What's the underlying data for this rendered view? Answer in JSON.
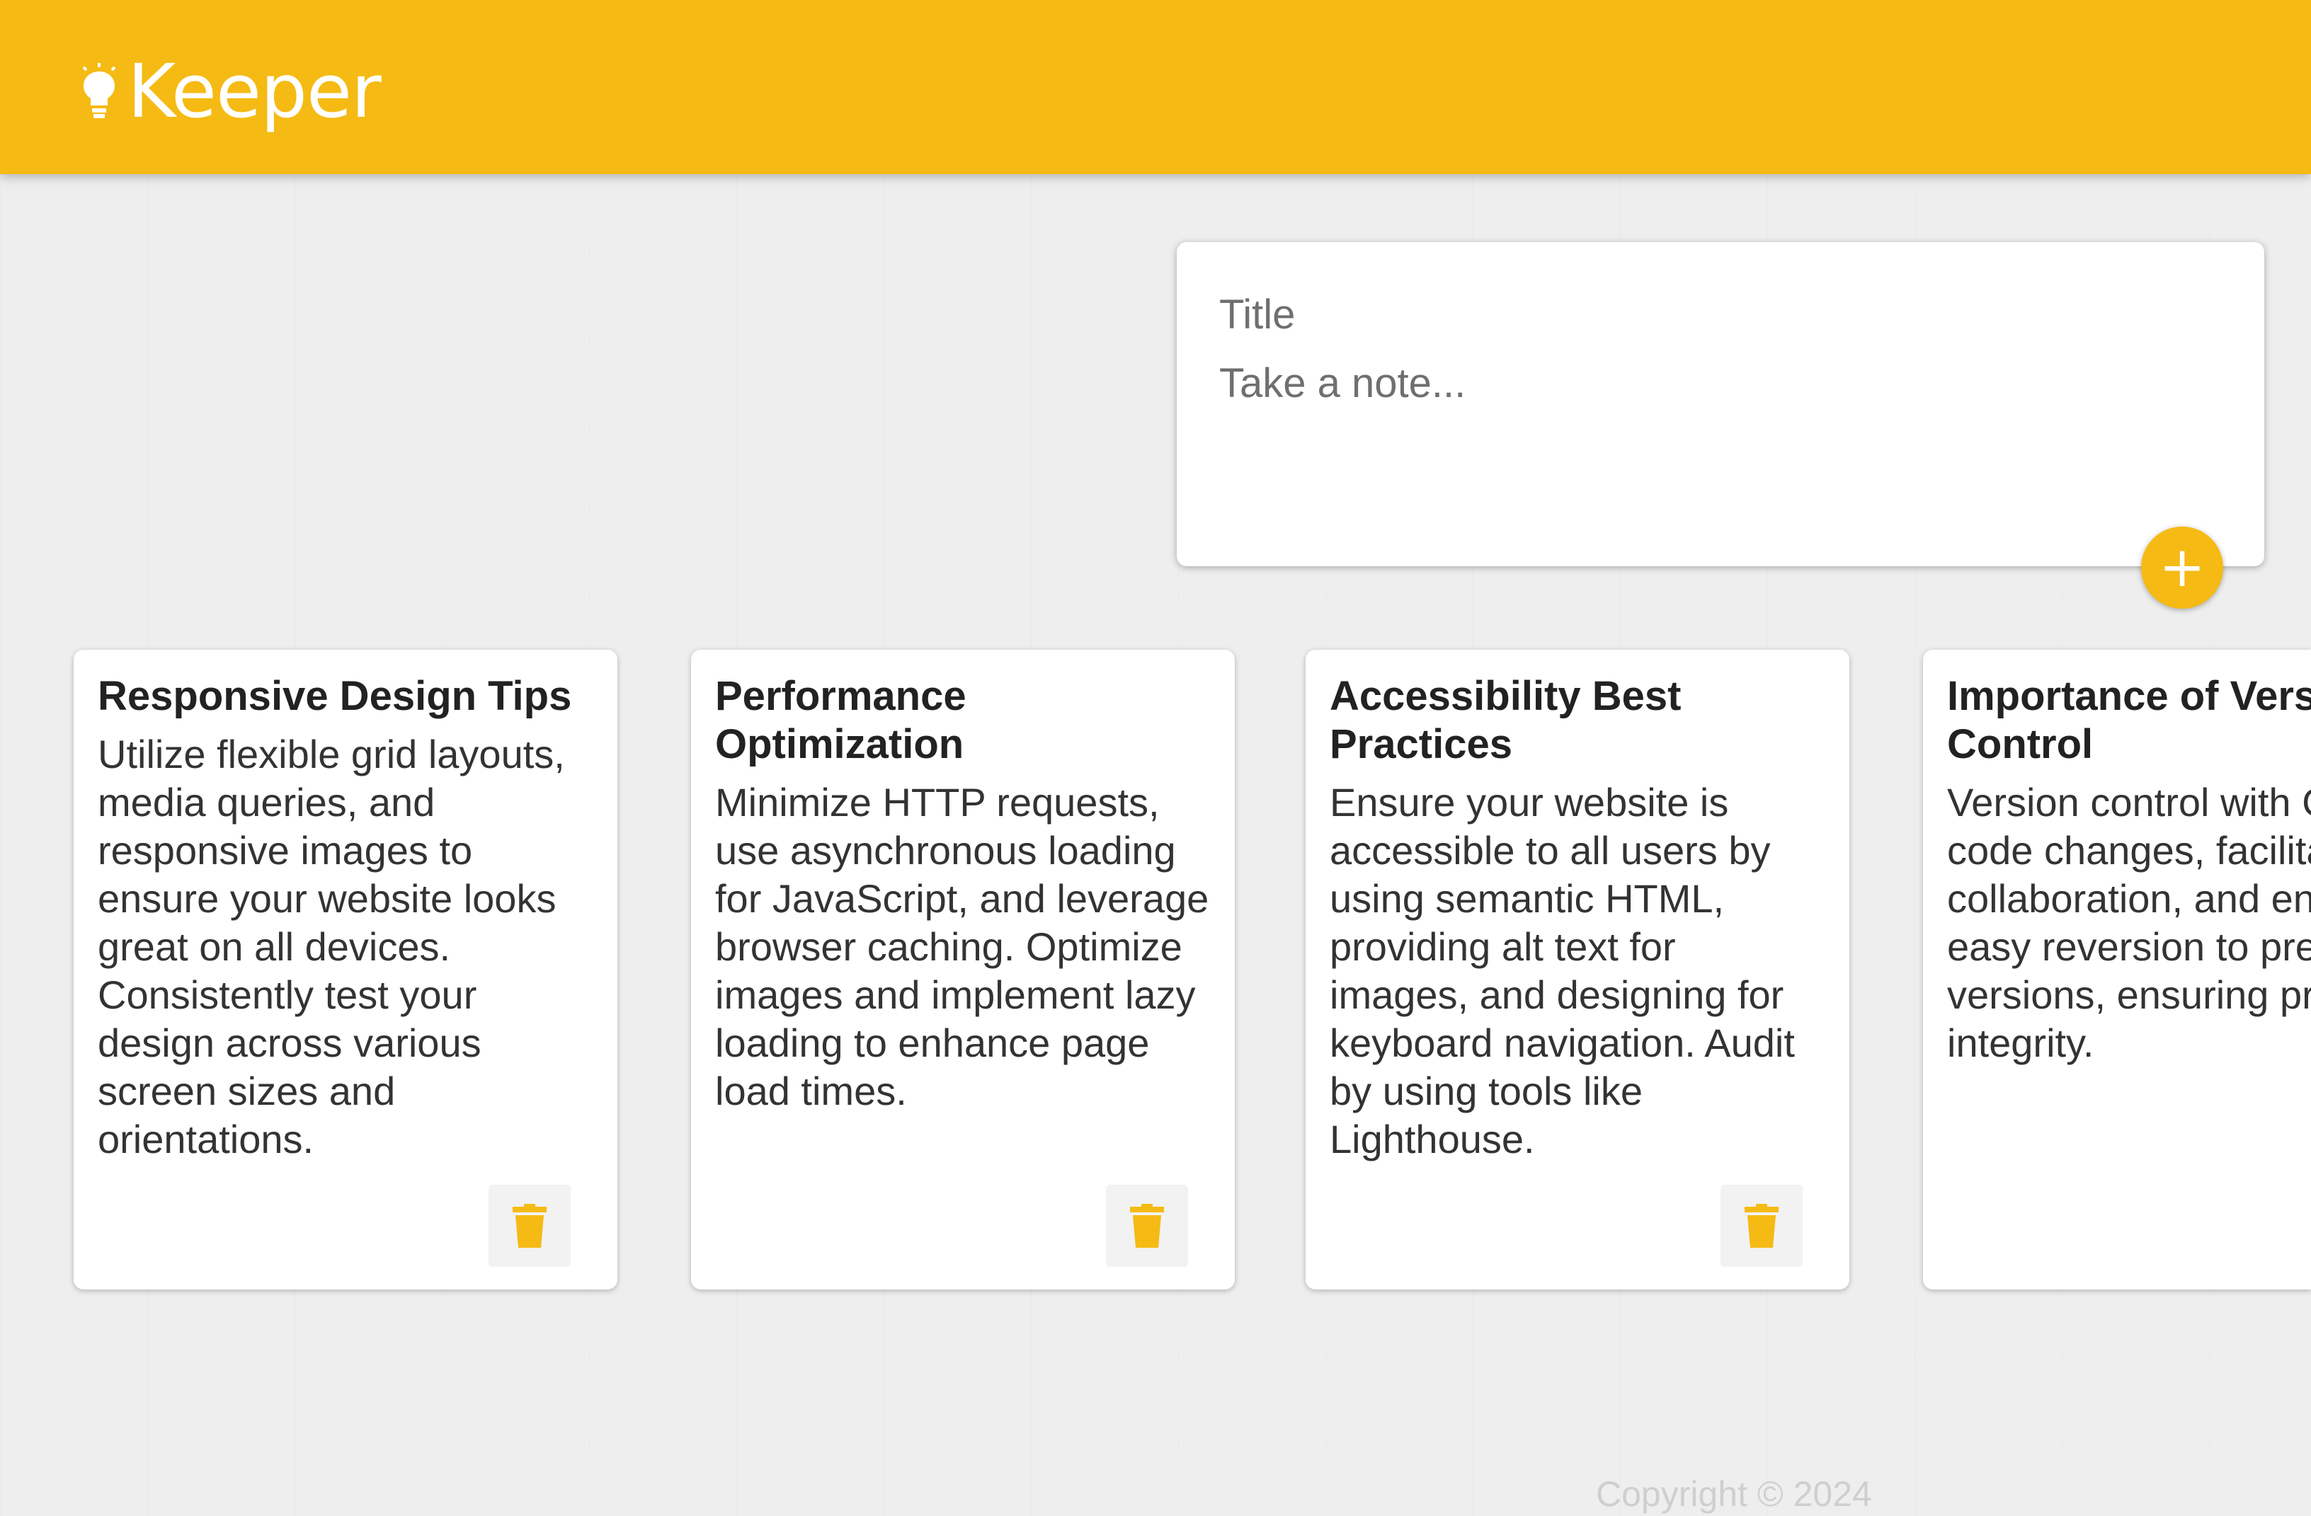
{
  "app": {
    "title": "Keeper",
    "brand_color": "#f5ba13",
    "logo_icon": "lightbulb-icon"
  },
  "create_note": {
    "title_placeholder": "Title",
    "content_placeholder": "Take a note...",
    "add_icon": "plus-icon",
    "add_label": "+"
  },
  "notes": [
    {
      "title": "Responsive Design Tips",
      "content": "Utilize flexible grid layouts, media queries, and responsive images to ensure your website looks great on all devices. Consistently test your design across various screen sizes and orientations.",
      "delete_icon": "trash-icon"
    },
    {
      "title": "Performance Optimization",
      "content": "Minimize HTTP requests, use asynchronous loading for JavaScript, and leverage browser caching. Optimize images and implement lazy loading to enhance page load times.",
      "delete_icon": "trash-icon"
    },
    {
      "title": "Accessibility Best Practices",
      "content": "Ensure your website is accessible to all users by using semantic HTML, providing alt text for images, and designing for keyboard navigation. Audit by using tools like Lighthouse.",
      "delete_icon": "trash-icon"
    },
    {
      "title": "Importance of Version Control",
      "content": "Version control with Git tracks code changes, facilitates team collaboration, and enables easy reversion to previous versions, ensuring project integrity.",
      "delete_icon": "trash-icon"
    }
  ],
  "footer": {
    "text": "Copyright © 2024"
  }
}
